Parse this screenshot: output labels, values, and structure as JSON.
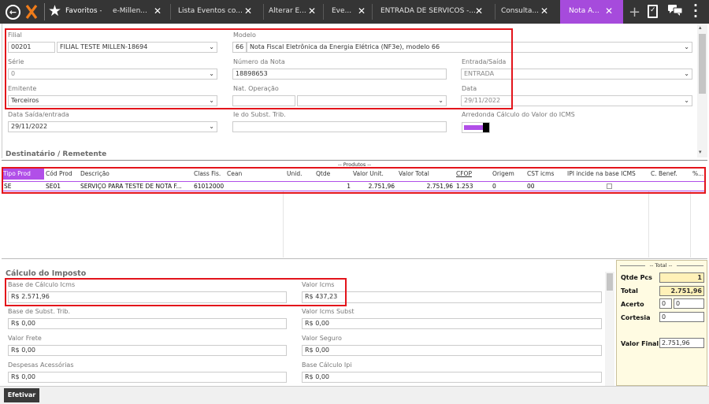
{
  "topbar": {
    "back_icon": "arrow-left-circle",
    "favoritos_label": "Favoritos",
    "favoritos_caret": "-",
    "tabs": [
      {
        "label": "e-Millen..."
      },
      {
        "label": "Lista Eventos co..."
      },
      {
        "label": "Alterar E..."
      },
      {
        "label": "Eve..."
      },
      {
        "label": "ENTRADA DE SERVICOS -..."
      },
      {
        "label": "Consulta..."
      },
      {
        "label": "Nota A..."
      }
    ],
    "close_glyph": "✕",
    "plus_glyph": "+"
  },
  "header_form": {
    "filial": {
      "label": "Filial",
      "code": "00201",
      "name": "FILIAL TESTE MILLEN-18694"
    },
    "modelo": {
      "label": "Modelo",
      "code": "66",
      "name": "Nota Fiscal Eletrônica da Energia Elétrica (NF3e), modelo 66"
    },
    "serie": {
      "label": "Série",
      "value": "0"
    },
    "numero_nota": {
      "label": "Número da Nota",
      "value": "18898653"
    },
    "entrada_saida": {
      "label": "Entrada/Saída",
      "value": "ENTRADA"
    },
    "emitente": {
      "label": "Emitente",
      "value": "Terceiros"
    },
    "nat_operacao": {
      "label": "Nat. Operação",
      "code": "",
      "value": ""
    },
    "data": {
      "label": "Data",
      "value": "29/11/2022"
    },
    "data_saida": {
      "label": "Data Saída/entrada",
      "value": "29/11/2022"
    },
    "ie_subst": {
      "label": "Ie do Subst. Trib.",
      "value": ""
    },
    "arredonda": {
      "label": "Arredonda Cálculo do Valor do ICMS"
    },
    "destinatario_title": "Destinatário / Remetente"
  },
  "products": {
    "title": "-- Produtos --",
    "columns": [
      "Tipo Prod",
      "Cód Prod",
      "Descrição",
      "Class Fis.",
      "Cean",
      "Unid.",
      "Qtde",
      "Valor Unit.",
      "Valor Total",
      "CFOP",
      "Origem",
      "CST icms",
      "IPI incide na base ICMS",
      "C. Benef.",
      "%..."
    ],
    "rows": [
      {
        "tipo": "SE",
        "cod": "SE01",
        "descricao": "SERVIÇO PARA TESTE DE NOTA F...",
        "class_fis": "61012000",
        "cean": "",
        "unid": "",
        "qtde": "1",
        "valor_unit": "2.751,96",
        "valor_total": "2.751,96",
        "cfop": "1.253",
        "origem": "0",
        "cst": "00",
        "ipi": false,
        "cbenef": "",
        "pct": ""
      }
    ]
  },
  "calculo": {
    "title": "Cálculo do Imposto",
    "fields": [
      {
        "label": "Base de Cálculo Icms",
        "value": "R$ 2.571,96"
      },
      {
        "label": "Valor Icms",
        "value": "R$ 437,23"
      },
      {
        "label": "Base de Subst. Trib.",
        "value": "R$ 0,00"
      },
      {
        "label": "Valor Icms Subst",
        "value": "R$ 0,00"
      },
      {
        "label": "Valor Frete",
        "value": "R$ 0,00"
      },
      {
        "label": "Valor Seguro",
        "value": "R$ 0,00"
      },
      {
        "label": "Despesas Acessórias",
        "value": "R$ 0,00"
      },
      {
        "label": "Base Cálculo Ipi",
        "value": "R$ 0,00"
      }
    ]
  },
  "total_panel": {
    "title": "-- Total --",
    "qtde_pcs_label": "Qtde Pcs",
    "qtde_pcs_value": "1",
    "total_label": "Total",
    "total_value": "2.751,96",
    "acerto_label": "Acerto",
    "acerto_value1": "0",
    "acerto_value2": "0",
    "cortesia_label": "Cortesia",
    "cortesia_value": "0",
    "valor_final_label": "Valor Final",
    "valor_final_value": "2.751,96"
  },
  "footer": {
    "efetivar_label": "Efetivar"
  },
  "colors": {
    "accent_purple": "#b14fe8",
    "highlight_red": "#e3141b",
    "topbar_bg": "#353535",
    "logo_orange": "#f07c1a"
  }
}
